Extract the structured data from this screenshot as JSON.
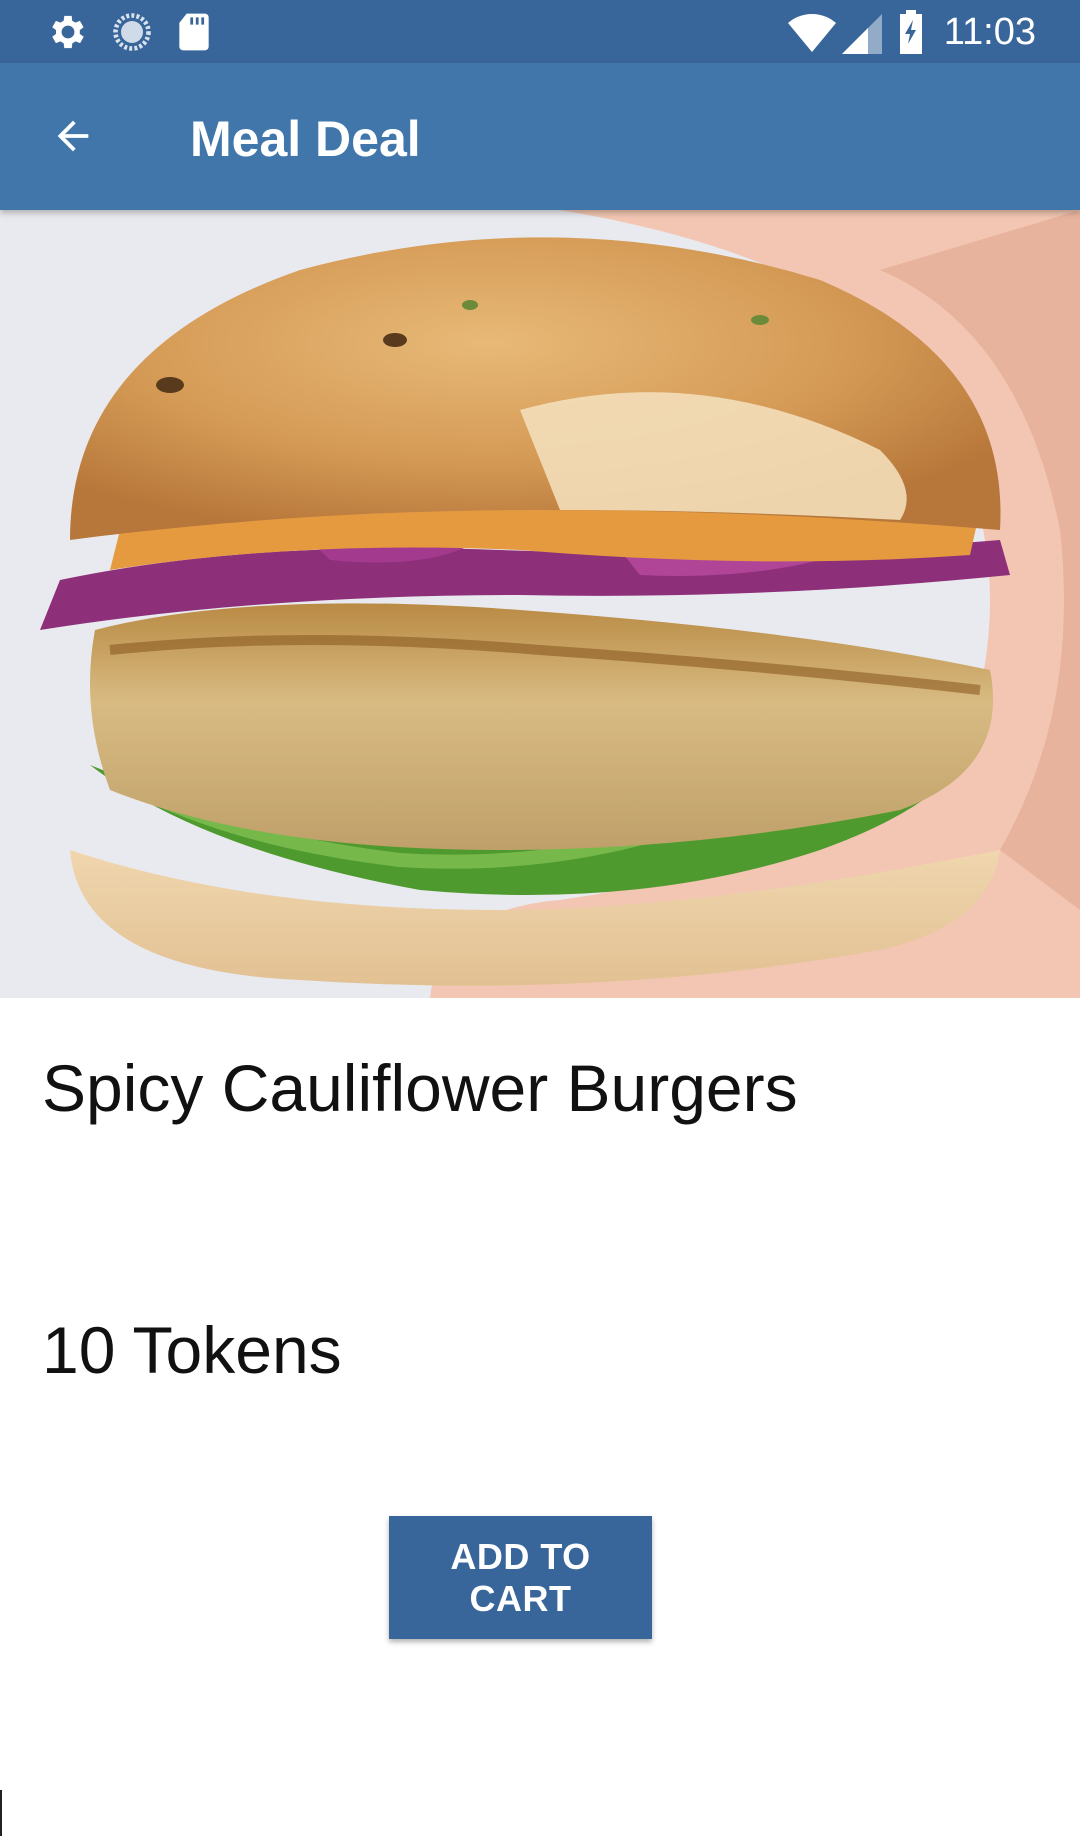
{
  "status_bar": {
    "time": "11:03",
    "left_icons": [
      "settings-icon",
      "loading-icon",
      "sd-card-icon"
    ],
    "right_icons": [
      "wifi-icon",
      "cell-signal-icon",
      "battery-charging-icon"
    ],
    "color": "#39669a"
  },
  "app_bar": {
    "title": "Meal Deal",
    "back_icon": "arrow-back-icon",
    "color": "#4176ab"
  },
  "meal": {
    "image_icon": "burger-photo",
    "name": "Spicy Cauliflower Burgers",
    "price": "10 Tokens",
    "add_to_cart_label": "ADD TO CART",
    "button_color": "#39669a"
  }
}
